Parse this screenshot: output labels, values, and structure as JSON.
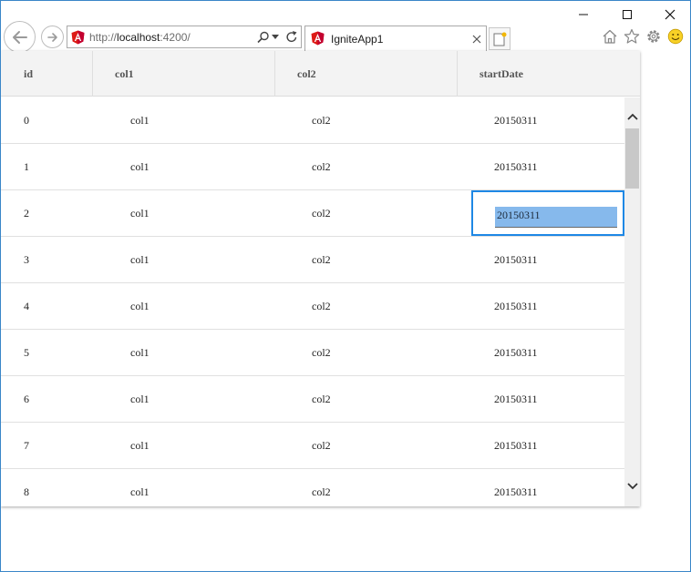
{
  "browser": {
    "address": {
      "protocol": "http://",
      "host": "localhost",
      "path": ":4200/"
    },
    "tab": {
      "title": "IgniteApp1"
    },
    "colors": {
      "angular_red": "#dd1b16",
      "selection_blue": "#1e88e5"
    }
  },
  "grid": {
    "columns": [
      {
        "key": "id",
        "label": "id"
      },
      {
        "key": "col1",
        "label": "col1"
      },
      {
        "key": "col2",
        "label": "col2"
      },
      {
        "key": "startDate",
        "label": "startDate"
      }
    ],
    "rows": [
      {
        "id": "0",
        "col1": "col1",
        "col2": "col2",
        "startDate": "20150311"
      },
      {
        "id": "1",
        "col1": "col1",
        "col2": "col2",
        "startDate": "20150311"
      },
      {
        "id": "2",
        "col1": "col1",
        "col2": "col2",
        "startDate": "20150311"
      },
      {
        "id": "3",
        "col1": "col1",
        "col2": "col2",
        "startDate": "20150311"
      },
      {
        "id": "4",
        "col1": "col1",
        "col2": "col2",
        "startDate": "20150311"
      },
      {
        "id": "5",
        "col1": "col1",
        "col2": "col2",
        "startDate": "20150311"
      },
      {
        "id": "6",
        "col1": "col1",
        "col2": "col2",
        "startDate": "20150311"
      },
      {
        "id": "7",
        "col1": "col1",
        "col2": "col2",
        "startDate": "20150311"
      },
      {
        "id": "8",
        "col1": "col1",
        "col2": "col2",
        "startDate": "20150311"
      }
    ],
    "editing": {
      "row": 2,
      "column": "startDate",
      "value": "20150311"
    }
  }
}
